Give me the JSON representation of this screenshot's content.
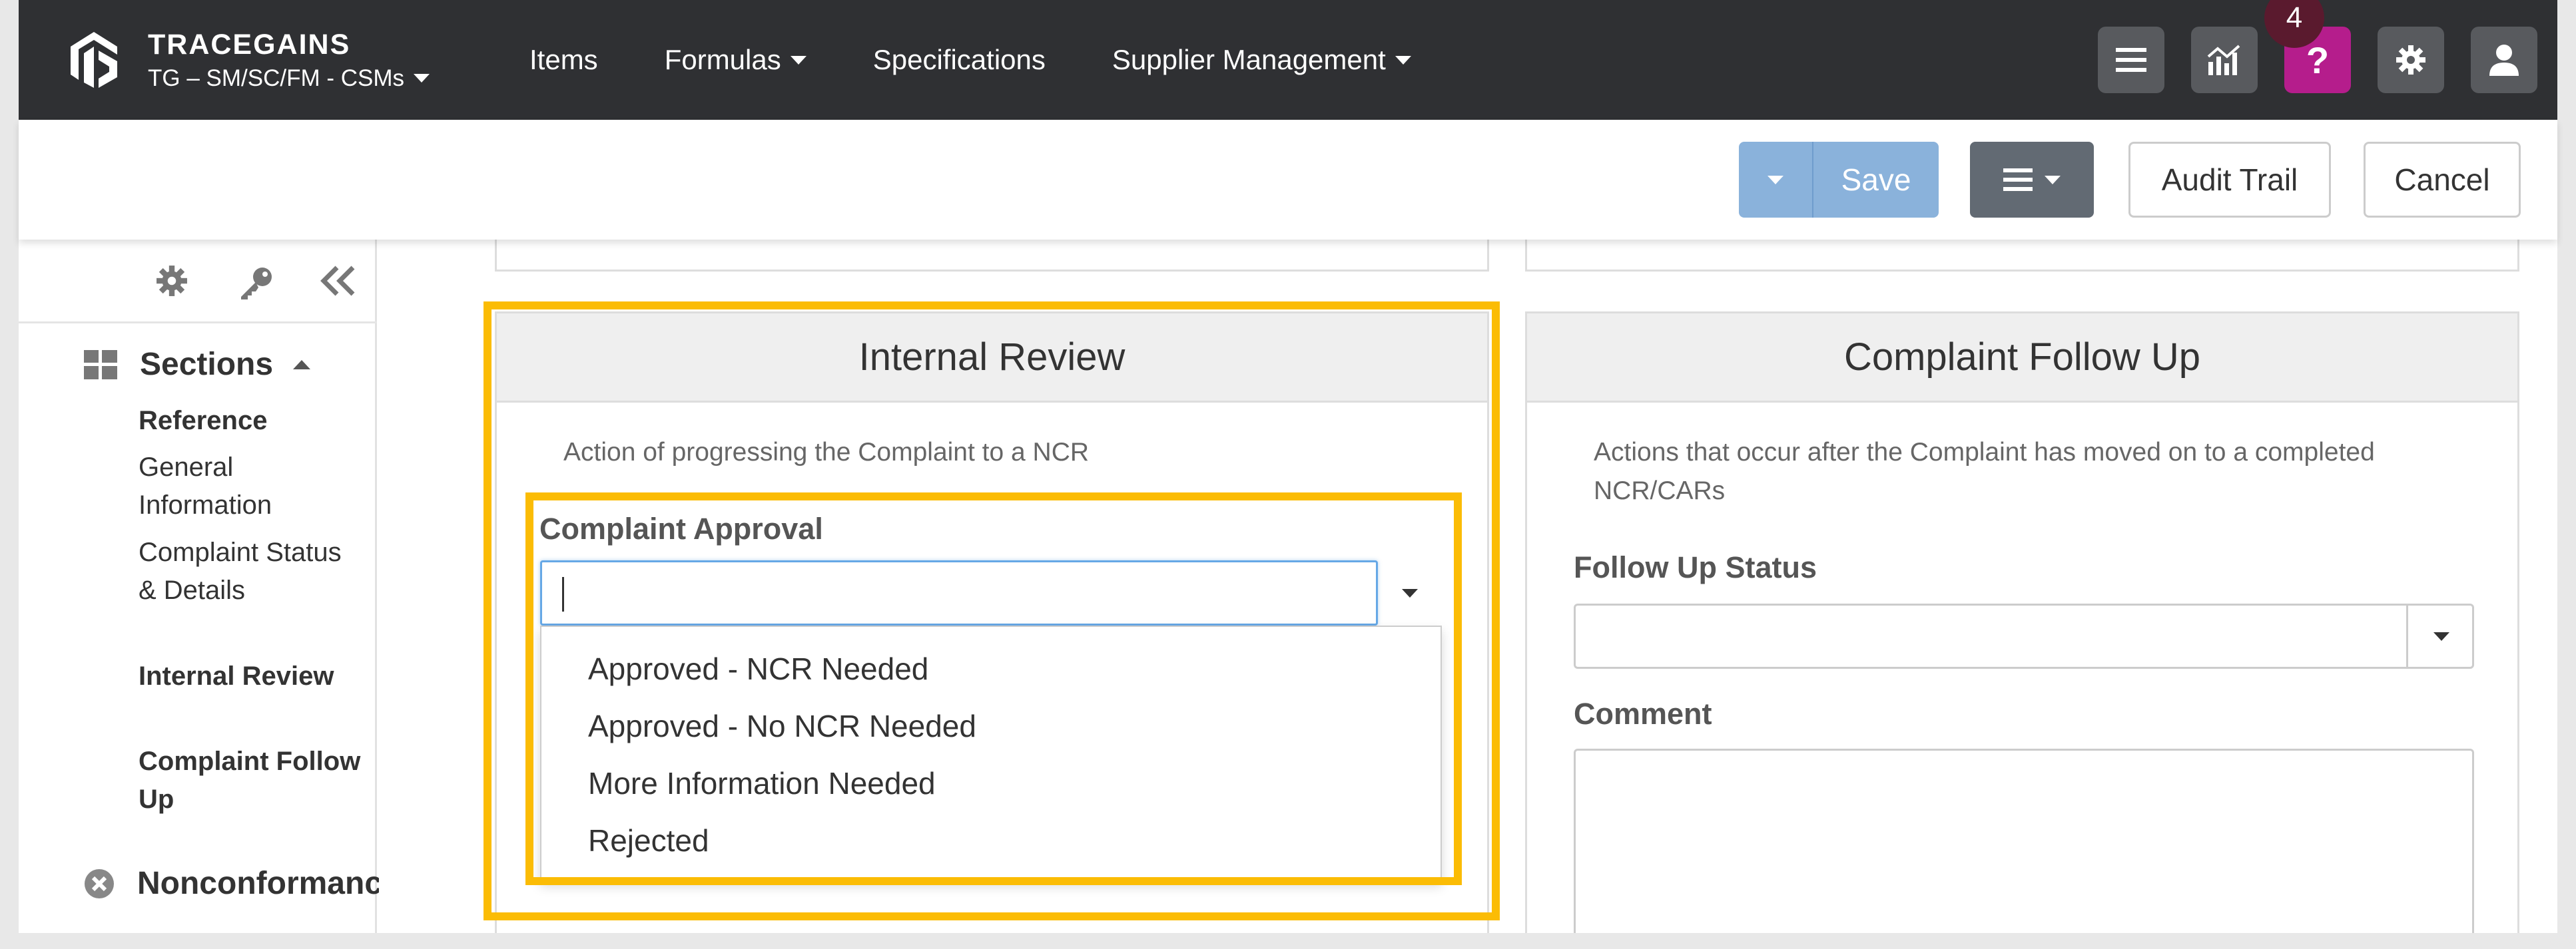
{
  "app": {
    "brand_name": "TRACEGAINS",
    "workspace": "TG – SM/SC/FM - CSMs"
  },
  "nav": {
    "items": [
      "Items",
      "Formulas",
      "Specifications",
      "Supplier Management"
    ],
    "help_badge_count": "4",
    "icons": [
      "list-icon",
      "analytics-icon",
      "help-icon",
      "gear-icon",
      "user-icon"
    ]
  },
  "toolbar": {
    "save_label": "Save",
    "audit_trail_label": "Audit Trail",
    "cancel_label": "Cancel"
  },
  "sidebar": {
    "sections_label": "Sections",
    "items": [
      {
        "label": "Reference",
        "bold": true
      },
      {
        "label": "General Information",
        "bold": false
      },
      {
        "label": "Complaint Status & Details",
        "bold": false
      },
      {
        "label": "Internal Review",
        "bold": true
      },
      {
        "label": "Complaint Follow Up",
        "bold": true
      }
    ],
    "nonconformance_label": "Nonconformanc"
  },
  "internal_review": {
    "title": "Internal Review",
    "description": "Action of progressing the Complaint to a NCR",
    "approval_label": "Complaint Approval",
    "approval_value": "",
    "options": [
      "Approved - NCR Needed",
      "Approved - No NCR Needed",
      "More Information Needed",
      "Rejected"
    ]
  },
  "followup": {
    "title": "Complaint Follow Up",
    "description": "Actions that occur after the Complaint has moved on to a completed NCR/CARs",
    "status_label": "Follow Up Status",
    "status_value": "",
    "comment_label": "Comment",
    "comment_value": ""
  },
  "colors": {
    "navbar": "#2f3033",
    "help_button": "#b51d8c",
    "save_button": "#8ab2db",
    "highlight": "#fbbc05"
  }
}
